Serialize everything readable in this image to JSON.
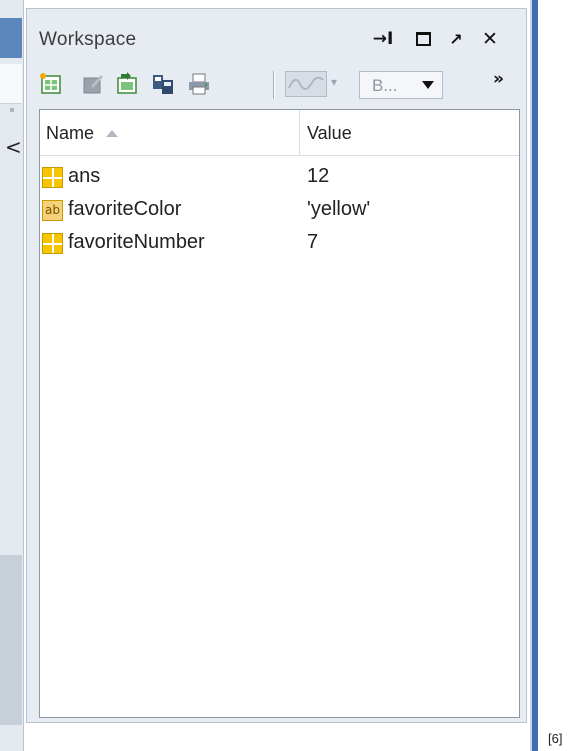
{
  "workspace": {
    "title": "Workspace",
    "window_controls": {
      "undock": "→I",
      "maximize": "☐",
      "minimize": "↗",
      "close": "✕"
    },
    "toolbar": {
      "tools": [
        "new-variable-icon",
        "edit-variable-icon",
        "import-data-icon",
        "save-workspace-icon",
        "print-icon"
      ],
      "plot_icon": "plot-icon",
      "stack_select_value": "B...",
      "overflow": "»"
    },
    "columns": {
      "name": "Name",
      "value": "Value"
    },
    "variables": [
      {
        "icon": "grid-icon",
        "name": "ans",
        "value": "12"
      },
      {
        "icon": "char-icon",
        "icon_text": "ab",
        "name": "favoriteColor",
        "value": "'yellow'"
      },
      {
        "icon": "grid-icon",
        "name": "favoriteNumber",
        "value": "7"
      }
    ]
  },
  "left_panel": {
    "chevron": "<"
  },
  "footnote": "[6]",
  "colors": {
    "panel_bg": "#e7ecf2",
    "accent_blue": "#3f6fb0",
    "numeric_icon": "#f7c400"
  }
}
